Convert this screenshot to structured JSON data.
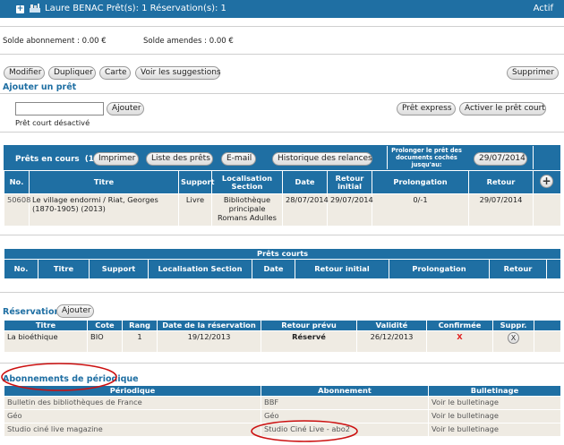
{
  "header": {
    "title": "Laure BENAC Prêt(s): 1 Réservation(s): 1",
    "status": "Actif"
  },
  "balances": {
    "subscription": "Solde abonnement : 0.00 €",
    "fines": "Solde amendes : 0.00 €"
  },
  "toolbar": {
    "modify": "Modifier",
    "duplicate": "Dupliquer",
    "card": "Carte",
    "suggestions": "Voir les suggestions",
    "delete": "Supprimer"
  },
  "add_loan": {
    "title": "Ajouter un prêt",
    "input_value": "",
    "add_button": "Ajouter",
    "short_loan_note": "Prêt court désactivé",
    "express_button": "Prêt express",
    "activate_short_button": "Activer le prêt court"
  },
  "current_loans": {
    "title": "Prêts en cours  (1)",
    "print": "Imprimer",
    "list": "Liste des prêts",
    "email": "E-mail",
    "history": "Historique des relances",
    "extend_label": "Prolonger le prêt des documents cochés jusqu'au:",
    "extend_date": "29/07/2014",
    "columns": [
      "No.",
      "Titre",
      "Support",
      "Localisation Section",
      "Date",
      "Retour initial",
      "Prolongation",
      "Retour"
    ],
    "rows": [
      {
        "no": "50608",
        "title": "Le village endormi / Riat, Georges (1870-1905) (2013)",
        "support": "Livre",
        "location": "Bibliothèque principale Romans Adulles",
        "date": "28/07/2014",
        "initial_return": "29/07/2014",
        "extension": "0/-1",
        "return": "29/07/2014"
      }
    ]
  },
  "short_loans": {
    "title": "Prêts courts",
    "columns": [
      "No.",
      "Titre",
      "Support",
      "Localisation Section",
      "Date",
      "Retour initial",
      "Prolongation",
      "Retour"
    ]
  },
  "reservations": {
    "title": "Réservations",
    "add_button": "Ajouter",
    "columns": [
      "Titre",
      "Cote",
      "Rang",
      "Date de la réservation",
      "Retour prévu",
      "Validité",
      "Confirmée",
      "Suppr."
    ],
    "rows": [
      {
        "title": "La bioéthique",
        "cote": "BIO",
        "rank": "1",
        "date": "19/12/2013",
        "expected_return": "Réservé",
        "validity": "26/12/2013",
        "confirmed": "X",
        "delete": "X"
      }
    ]
  },
  "subscriptions": {
    "title": "Abonnements de périodique",
    "columns": [
      "Périodique",
      "Abonnement",
      "Bulletinage"
    ],
    "rows": [
      {
        "periodical": "Bulletin des bibliothèques de France",
        "subscription": "BBF",
        "bulletinage": "Voir le bulletinage"
      },
      {
        "periodical": "Géo",
        "subscription": "Géo",
        "bulletinage": "Voir le bulletinage"
      },
      {
        "periodical": "Studio ciné live magazine",
        "subscription": "Studio Ciné Live - abo2",
        "bulletinage": "Voir le bulletinage"
      }
    ]
  },
  "colors": {
    "header_blue": "#1f6fa3",
    "row_beige": "#efebe3",
    "annotation_red": "#cc1111"
  }
}
